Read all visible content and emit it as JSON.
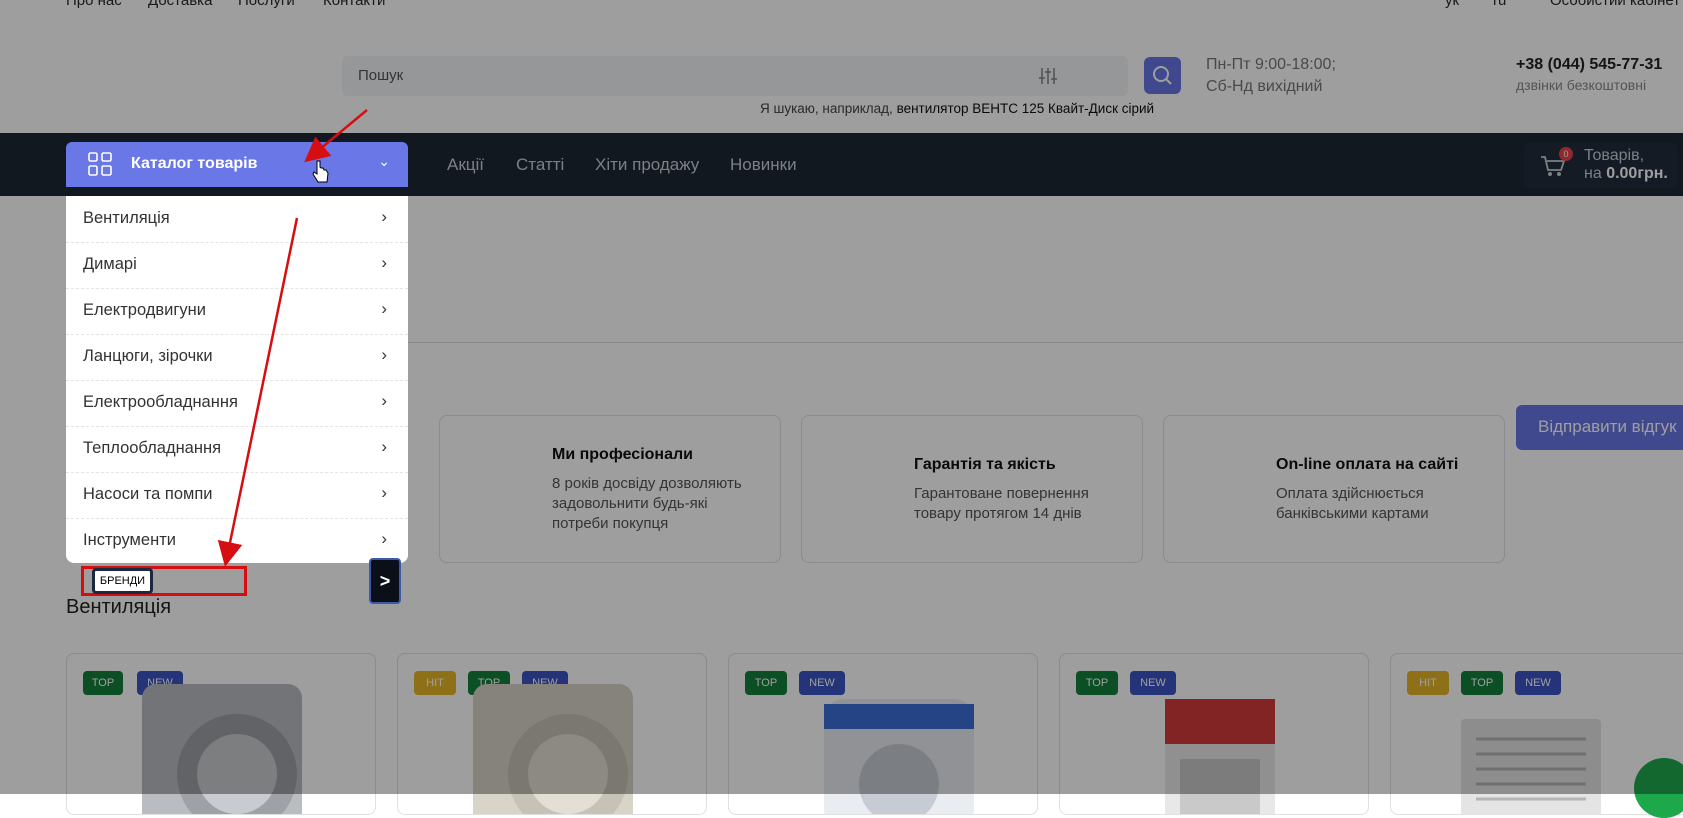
{
  "top_nav": {
    "links": [
      "Про нас",
      "Доставка",
      "Послуги",
      "Контакти"
    ],
    "lang_ru": "ук",
    "lang_ua": "ru",
    "account": "Особистий кабінет"
  },
  "search": {
    "placeholder": "Пошук",
    "hint_prefix": "Я шукаю, наприклад,",
    "hint_example": "вентилятор ВЕНТС 125 Квайт-Диск сірий"
  },
  "contacts": {
    "hours_line1": "Пн-Пт 9:00-18:00;",
    "hours_line2": "Сб-Нд вихідний",
    "phone": "+38 (044) 545-77-31",
    "phone_note": "дзвінки безкоштовні"
  },
  "navbar": {
    "catalog_label": "Каталог товарів",
    "links": [
      "Акції",
      "Статті",
      "Хіти продажу",
      "Новинки"
    ],
    "cart": {
      "count": "0",
      "line1": "Товарів,",
      "line2_prefix": "на",
      "total": "0.00грн."
    }
  },
  "catalog_menu": [
    "Вентиляція",
    "Димарі",
    "Електродвигуни",
    "Ланцюги, зірочки",
    "Електрообладнання",
    "Теплообладнання",
    "Насоси та помпи",
    "Інструменти"
  ],
  "menu_arrow": "›",
  "catalog_chevron": "⌄",
  "brands_label": "БРЕНДИ",
  "next_button": ">",
  "features": [
    {
      "title": "Ми професіонали",
      "desc": "8 років досвіду дозволяють задовольнити будь-які потреби покупця"
    },
    {
      "title": "Гарантія та якість",
      "desc": "Гарантоване повернення товару протягом 14 днів"
    },
    {
      "title": "On-line оплата на сайті",
      "desc": "Оплата здійснюється банківськими картами"
    }
  ],
  "review_button": "Відправити відгук",
  "section_title": "Вентиляція",
  "product_tags": [
    [
      "TOP",
      "NEW"
    ],
    [
      "HIT",
      "TOP",
      "NEW"
    ],
    [
      "TOP",
      "NEW"
    ],
    [
      "TOP",
      "NEW"
    ],
    [
      "HIT",
      "TOP",
      "NEW"
    ]
  ],
  "colors": {
    "accent": "#6a77e6",
    "navbar": "#1d2733",
    "tag_top": "#14803d",
    "tag_new": "#3d55c4",
    "tag_hit": "#e6b528",
    "annotation_red": "#d60e12"
  }
}
